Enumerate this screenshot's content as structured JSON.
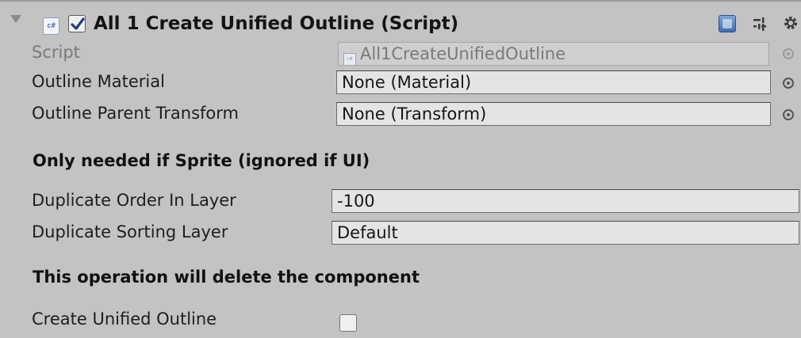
{
  "component": {
    "title": "All 1 Create Unified Outline (Script)",
    "enabled": true,
    "script_icon_text": "c#"
  },
  "fields": {
    "script": {
      "label": "Script",
      "value": "All1CreateUnifiedOutline",
      "mini_icon_text": "c#"
    },
    "outline_material": {
      "label": "Outline Material",
      "value": "None (Material)"
    },
    "outline_parent_transform": {
      "label": "Outline Parent Transform",
      "value": "None (Transform)"
    },
    "duplicate_order_in_layer": {
      "label": "Duplicate Order In Layer",
      "value": "-100"
    },
    "duplicate_sorting_layer": {
      "label": "Duplicate Sorting Layer",
      "value": "Default"
    },
    "create_unified_outline": {
      "label": "Create Unified Outline",
      "checked": false
    }
  },
  "sections": {
    "sprite_only": "Only needed if Sprite (ignored if UI)",
    "delete_warning": "This operation will delete the component"
  },
  "icons": {
    "foldout": "foldout-arrow-icon",
    "script": "csharp-script-icon",
    "help": "help-book-icon",
    "layout": "presets-sliders-icon",
    "settings": "gear-icon",
    "object_picker": "object-picker-icon"
  },
  "colors": {
    "panel_bg": "#c3c3c3",
    "field_bg": "#e4e4e4",
    "help_blue": "#3d6fb0"
  }
}
